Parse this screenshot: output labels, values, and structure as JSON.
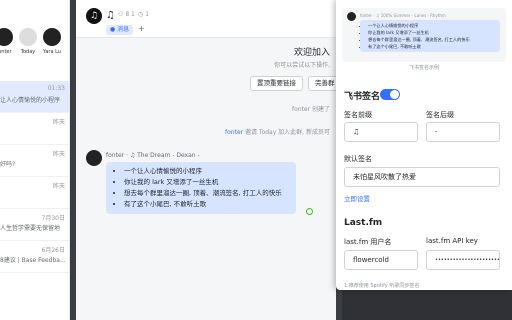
{
  "chat_list": {
    "avatars": [
      {
        "label": "fonter"
      },
      {
        "label": "Today"
      },
      {
        "label": "Yara Lu"
      }
    ],
    "rows": [
      {
        "time": "01:33",
        "text": "让人心情愉悦的小程序"
      },
      {
        "time": "昨天",
        "text": ""
      },
      {
        "time": "昨天",
        "text": "好吗?"
      },
      {
        "time": "昨天",
        "text": ""
      },
      {
        "time": "7月30日",
        "text": "人生哲学需要无保留地"
      },
      {
        "time": "6月26日",
        "text": "8建议 | Base Feedba..."
      }
    ]
  },
  "chat": {
    "title": "♫",
    "stat_members": "8 1",
    "stat_other": "1",
    "tab_label": "消息",
    "tab_add": "+",
    "welcome_title": "欢迎加入",
    "welcome_sub": "你可以尝试以下操作,",
    "buttons": [
      "置顶重要链接",
      "完善群"
    ],
    "system_1": "fonter 创建了",
    "system_2_user": "fonter",
    "system_2_rest": " 邀请 Today 加入此群, 新成员可",
    "message": {
      "meta": "fonter · ♫ The Dream - Dexan -",
      "lines": [
        "一个让人心情愉悦的小程序",
        "你让我的 lark 又增添了一丝生机",
        "想去每个群里溜达一圈, 顶着、潮流签名, 打工人的快乐",
        "有了这个小尾巴, 不敢听土歌"
      ]
    }
  },
  "panel": {
    "preview": {
      "meta": "fonter · ♫ 100% Summer - Lanes - Rhythm",
      "lines": [
        "一个让人心情愉悦的小程序",
        "你让我的 lark 又增添了一丝生机",
        "想去每个群里溜达一圈, 顶着、潮流签名, 打工人的快乐",
        "有了这个小尾巴, 不敢听土歌"
      ],
      "caption": "飞书签名示例"
    },
    "feishu_section": "飞书签名",
    "toggle_on": true,
    "prefix_label": "签名前缀",
    "prefix_value": "♫",
    "suffix_label": "签名后缀",
    "suffix_value": "-",
    "default_label": "默认签名",
    "default_value": "未怕星风吹散了热爱",
    "settings_link": "立即设置",
    "lastfm_section": "Last.fm",
    "user_label": "last.fm 用户名",
    "user_value": "flowercold",
    "key_label": "last.fm API key",
    "key_value": "••••••••••••••••••••••••••••",
    "footnote": "1.推荐使用 Spotify 听歌同步签名"
  },
  "colors": {
    "accent": "#3370ff",
    "bubble": "#d6e4ff",
    "toggle": "#3370ff"
  }
}
